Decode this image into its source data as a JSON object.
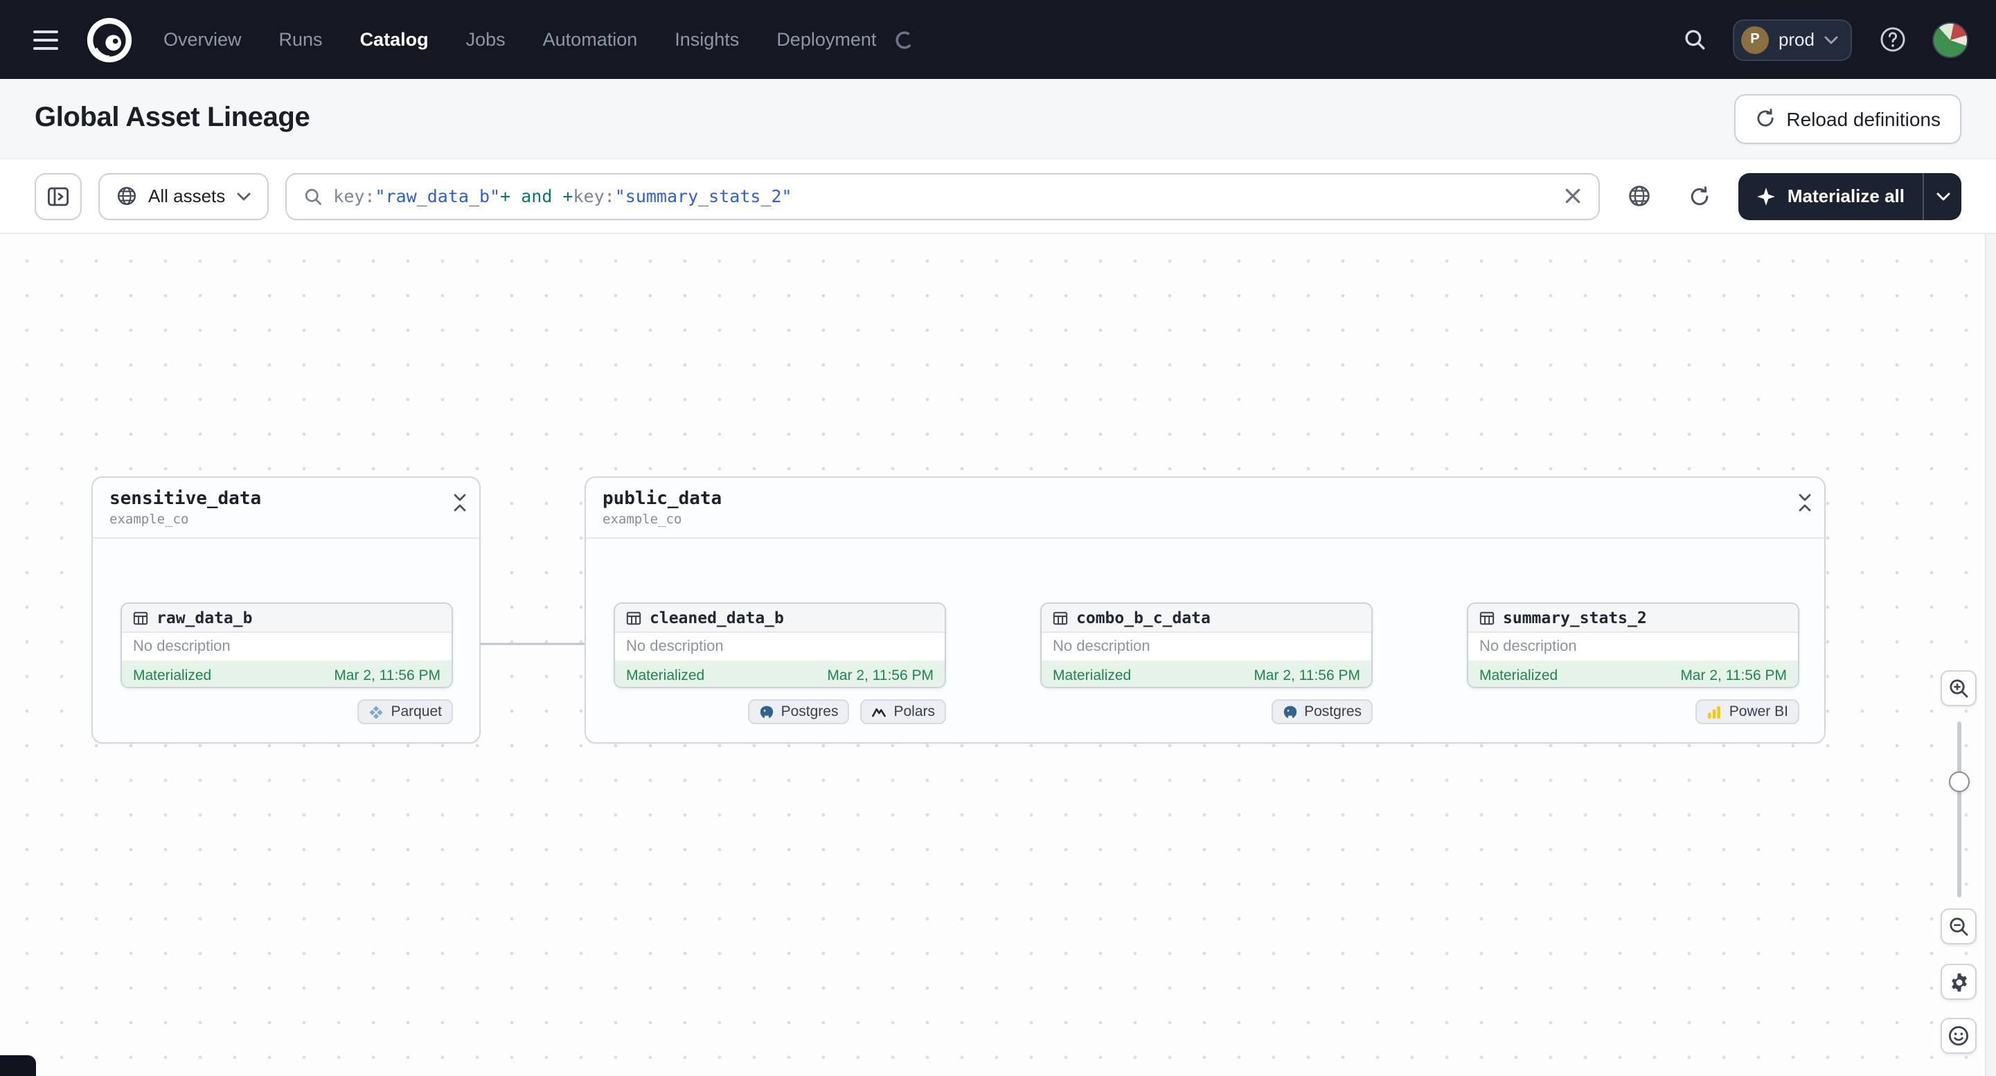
{
  "nav": {
    "items": [
      {
        "label": "Overview"
      },
      {
        "label": "Runs"
      },
      {
        "label": "Catalog"
      },
      {
        "label": "Jobs"
      },
      {
        "label": "Automation"
      },
      {
        "label": "Insights"
      },
      {
        "label": "Deployment"
      }
    ],
    "active_item": "Catalog",
    "deployment": {
      "initial": "P",
      "name": "prod"
    }
  },
  "header": {
    "title": "Global Asset Lineage",
    "reload_button_label": "Reload definitions"
  },
  "toolbar": {
    "asset_filter_label": "All assets",
    "search": {
      "tokens": [
        {
          "text": "key:",
          "type": "key"
        },
        {
          "text": "\"raw_data_b\"",
          "type": "value"
        },
        {
          "text": "+ and +",
          "type": "operator"
        },
        {
          "text": "key:",
          "type": "key"
        },
        {
          "text": "\"summary_stats_2\"",
          "type": "value"
        }
      ]
    },
    "materialize_button_label": "Materialize all"
  },
  "graph": {
    "groups": [
      {
        "name": "sensitive_data",
        "location": "example_co",
        "assets": [
          {
            "name": "raw_data_b",
            "description": "No description",
            "status": "Materialized",
            "timestamp": "Mar 2, 11:56 PM",
            "tags": [
              {
                "label": "Parquet",
                "icon": "parquet"
              }
            ]
          }
        ]
      },
      {
        "name": "public_data",
        "location": "example_co",
        "assets": [
          {
            "name": "cleaned_data_b",
            "description": "No description",
            "status": "Materialized",
            "timestamp": "Mar 2, 11:56 PM",
            "tags": [
              {
                "label": "Postgres",
                "icon": "postgres"
              },
              {
                "label": "Polars",
                "icon": "polars"
              }
            ]
          },
          {
            "name": "combo_b_c_data",
            "description": "No description",
            "status": "Materialized",
            "timestamp": "Mar 2, 11:56 PM",
            "tags": [
              {
                "label": "Postgres",
                "icon": "postgres"
              }
            ]
          },
          {
            "name": "summary_stats_2",
            "description": "No description",
            "status": "Materialized",
            "timestamp": "Mar 2, 11:56 PM",
            "tags": [
              {
                "label": "Power BI",
                "icon": "powerbi"
              }
            ]
          }
        ]
      }
    ]
  },
  "colors": {
    "nav_bg": "#151823",
    "accent_blue": "#2e5fd0",
    "status_green": "#20854a",
    "status_green_bg": "#e5f3ea"
  }
}
